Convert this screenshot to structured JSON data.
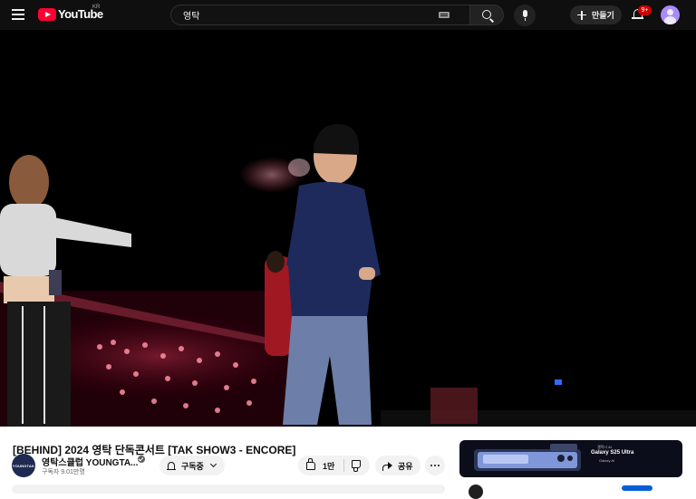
{
  "masthead": {
    "logo_text": "YouTube",
    "country_code": "KR",
    "search_value": "영탁",
    "search_placeholder": "검색",
    "create_label": "만들기",
    "notification_count": "9+"
  },
  "video": {
    "title": "[BEHIND] 2024 영탁 단독콘서트 [TAK SHOW3 - ENCORE]"
  },
  "channel": {
    "name": "영탁스클럽 YOUNGTA...",
    "avatar_text": "YOUNGTAK",
    "subscribers": "구독자 9.01만명",
    "subscribed_label": "구독중"
  },
  "actions": {
    "like_count": "1만",
    "share_label": "공유"
  },
  "ad": {
    "brand": "갤럭시 AI",
    "product": "Galaxy S25 Ultra",
    "tagline": "Galaxy AI"
  },
  "colors": {
    "masthead_bg": "#0f0f0f",
    "logo_red": "#ff0033",
    "page_bg": "#ffffff",
    "pill_bg": "#f2f2f2"
  }
}
